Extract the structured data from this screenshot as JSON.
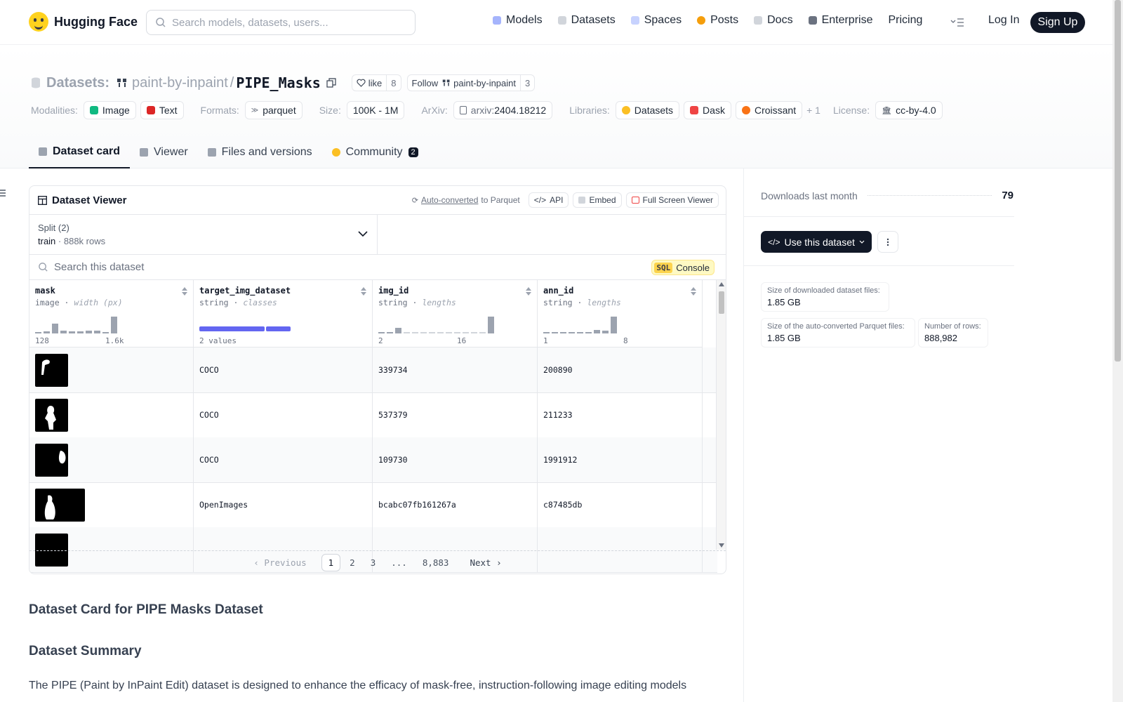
{
  "brand": {
    "name": "Hugging Face"
  },
  "search": {
    "placeholder": "Search models, datasets, users..."
  },
  "nav": {
    "items": [
      {
        "label": "Models",
        "icon": "models-icon",
        "color": "#a5b4fc"
      },
      {
        "label": "Datasets",
        "icon": "datasets-icon",
        "color": "#d1d5db"
      },
      {
        "label": "Spaces",
        "icon": "spaces-icon",
        "color": "#c7d2fe"
      },
      {
        "label": "Posts",
        "icon": "posts-icon",
        "color": "#f59e0b"
      },
      {
        "label": "Docs",
        "icon": "docs-icon",
        "color": "#d1d5db"
      },
      {
        "label": "Enterprise",
        "icon": "enterprise-icon",
        "color": "#6b7280"
      },
      {
        "label": "Pricing",
        "icon": "",
        "color": ""
      }
    ],
    "login": "Log In",
    "signup": "Sign Up"
  },
  "breadcrumb": {
    "section": "Datasets:",
    "owner": "paint-by-inpaint",
    "separator": "/",
    "name": "PIPE_Masks"
  },
  "like": {
    "label": "like",
    "count": "8"
  },
  "follow": {
    "label": "Follow",
    "org": "paint-by-inpaint",
    "count": "3"
  },
  "tags": {
    "modalities_label": "Modalities:",
    "modalities": [
      "Image",
      "Text"
    ],
    "formats_label": "Formats:",
    "formats": [
      "parquet"
    ],
    "size_label": "Size:",
    "size": "100K - 1M",
    "arxiv_label": "ArXiv:",
    "arxiv_prefix": "arxiv:",
    "arxiv_id": "2404.18212",
    "libraries_label": "Libraries:",
    "libraries": [
      "Datasets",
      "Dask",
      "Croissant"
    ],
    "libraries_more": "+ 1",
    "license_label": "License:",
    "license": "cc-by-4.0"
  },
  "tabs": [
    {
      "label": "Dataset card",
      "active": true
    },
    {
      "label": "Viewer",
      "active": false
    },
    {
      "label": "Files and versions",
      "active": false
    },
    {
      "label": "Community",
      "active": false,
      "badge": "2"
    }
  ],
  "viewer": {
    "title": "Dataset Viewer",
    "auto_converted": "Auto-converted",
    "to_parquet": "to Parquet",
    "api": "API",
    "embed": "Embed",
    "fullscreen": "Full Screen Viewer",
    "split_label": "Split (2)",
    "split_name": "train",
    "split_rows": "888k rows",
    "search_placeholder": "Search this dataset",
    "sql": "SQL",
    "console": "Console",
    "columns": [
      {
        "name": "mask",
        "type": "image",
        "stat": "width (px)",
        "min": "128",
        "max": "1.6k",
        "hist": [
          0.05,
          0.1,
          0.5,
          0.15,
          0.1,
          0.1,
          0.15,
          0.15,
          0.05,
          0.9
        ]
      },
      {
        "name": "target_img_dataset",
        "type": "string",
        "stat": "classes",
        "min": "2 values",
        "max": "",
        "classes": [
          0.73,
          0.27
        ]
      },
      {
        "name": "img_id",
        "type": "string",
        "stat": "lengths",
        "min": "2",
        "max": "16",
        "hist": [
          0.05,
          0.05,
          0.3,
          0.02,
          0.02,
          0.02,
          0.02,
          0.02,
          0.02,
          0.02,
          0.02,
          0.02,
          0.02,
          0.9
        ]
      },
      {
        "name": "ann_id",
        "type": "string",
        "stat": "lengths",
        "min": "1",
        "max": "8",
        "hist": [
          0.05,
          0.05,
          0.05,
          0.05,
          0.05,
          0.05,
          0.2,
          0.15,
          0.9
        ]
      }
    ],
    "rows": [
      {
        "target_img_dataset": "COCO",
        "img_id": "339734",
        "ann_id": "200890"
      },
      {
        "target_img_dataset": "COCO",
        "img_id": "537379",
        "ann_id": "211233"
      },
      {
        "target_img_dataset": "COCO",
        "img_id": "109730",
        "ann_id": "1991912"
      },
      {
        "target_img_dataset": "OpenImages",
        "img_id": "bcabc07fb161267a",
        "ann_id": "c87485db"
      }
    ],
    "pager": {
      "previous": "Previous",
      "pages": [
        "1",
        "2",
        "3",
        "...",
        "8,883"
      ],
      "current": "1",
      "next": "Next"
    }
  },
  "card": {
    "heading": "Dataset Card for PIPE Masks Dataset",
    "summary_heading": "Dataset Summary",
    "summary_text": "The PIPE (Paint by InPaint Edit) dataset is designed to enhance the efficacy of mask-free, instruction-following image editing models"
  },
  "sidebar": {
    "downloads_label": "Downloads last month",
    "downloads_value": "79",
    "use_button": "Use this dataset",
    "stats": [
      {
        "label": "Size of downloaded dataset files:",
        "value": "1.85 GB"
      },
      {
        "label": "Size of the auto-converted Parquet files:",
        "value": "1.85 GB"
      },
      {
        "label": "Number of rows:",
        "value": "888,982"
      }
    ]
  },
  "colors": {
    "accent_dark": "#111827",
    "class_bar": "#6366f1",
    "sql_yellow": "#fcd34d"
  }
}
